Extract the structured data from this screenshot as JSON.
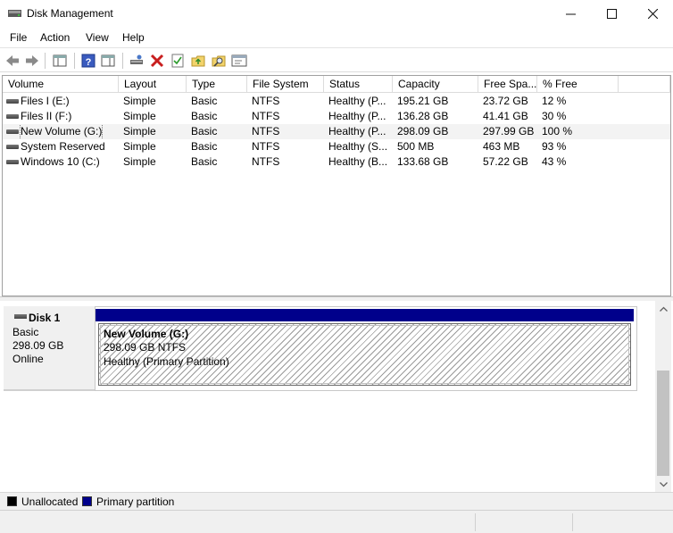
{
  "window": {
    "title": "Disk Management",
    "controls": {
      "minimize": "—",
      "maximize": "☐",
      "close": "✕"
    }
  },
  "menu": {
    "items": [
      {
        "label": "File"
      },
      {
        "label": "Action"
      },
      {
        "label": "View"
      },
      {
        "label": "Help"
      }
    ]
  },
  "toolbar": {
    "icons": [
      "back-arrow-icon",
      "forward-arrow-icon",
      "console-tree-icon",
      "help-icon",
      "properties-pane-icon",
      "connect-drive-icon",
      "delete-icon",
      "check-icon",
      "folder-up-icon",
      "search-folder-icon",
      "window-icon"
    ]
  },
  "volume_list": {
    "columns": [
      "Volume",
      "Layout",
      "Type",
      "File System",
      "Status",
      "Capacity",
      "Free Spa...",
      "% Free"
    ],
    "rows": [
      {
        "volume": "Files I (E:)",
        "layout": "Simple",
        "type": "Basic",
        "fs": "NTFS",
        "status": "Healthy (P...",
        "capacity": "195.21 GB",
        "free": "23.72 GB",
        "pct": "12 %"
      },
      {
        "volume": "Files II (F:)",
        "layout": "Simple",
        "type": "Basic",
        "fs": "NTFS",
        "status": "Healthy (P...",
        "capacity": "136.28 GB",
        "free": "41.41 GB",
        "pct": "30 %"
      },
      {
        "volume": "New Volume (G:)",
        "layout": "Simple",
        "type": "Basic",
        "fs": "NTFS",
        "status": "Healthy (P...",
        "capacity": "298.09 GB",
        "free": "297.99 GB",
        "pct": "100 %"
      },
      {
        "volume": "System Reserved",
        "layout": "Simple",
        "type": "Basic",
        "fs": "NTFS",
        "status": "Healthy (S...",
        "capacity": "500 MB",
        "free": "463 MB",
        "pct": "93 %"
      },
      {
        "volume": "Windows 10 (C:)",
        "layout": "Simple",
        "type": "Basic",
        "fs": "NTFS",
        "status": "Healthy (B...",
        "capacity": "133.68 GB",
        "free": "57.22 GB",
        "pct": "43 %"
      }
    ],
    "selected_index": 2
  },
  "disk": {
    "name": "Disk 1",
    "type": "Basic",
    "size": "298.09 GB",
    "state": "Online",
    "partition": {
      "name": "New Volume  (G:)",
      "size_fs": "298.09 GB NTFS",
      "status": "Healthy (Primary Partition)",
      "color": "#00008b"
    }
  },
  "legend": [
    {
      "label": "Unallocated",
      "color": "#000000"
    },
    {
      "label": "Primary partition",
      "color": "#00008b"
    }
  ]
}
